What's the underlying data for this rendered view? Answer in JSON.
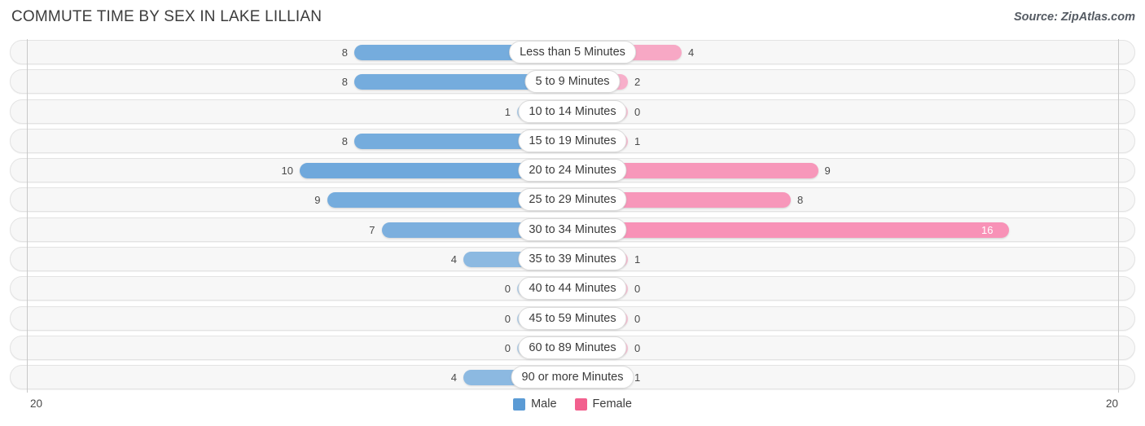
{
  "header": {
    "title": "COMMUTE TIME BY SEX IN LAKE LILLIAN",
    "source": "Source: ZipAtlas.com"
  },
  "legend": {
    "male_label": "Male",
    "female_label": "Female",
    "male_color": "#5b9bd5",
    "female_color": "#f2608e"
  },
  "axis": {
    "left_end_label": "20",
    "right_end_label": "20"
  },
  "chart_data": {
    "type": "bar",
    "title": "COMMUTE TIME BY SEX IN LAKE LILLIAN",
    "subtitle": "Source: ZipAtlas.com",
    "orientation": "horizontal-diverging",
    "xlabel": "",
    "ylabel": "",
    "xlim": [
      20,
      20
    ],
    "grid": false,
    "legend_position": "bottom-center",
    "categories": [
      "Less than 5 Minutes",
      "5 to 9 Minutes",
      "10 to 14 Minutes",
      "15 to 19 Minutes",
      "20 to 24 Minutes",
      "25 to 29 Minutes",
      "30 to 34 Minutes",
      "35 to 39 Minutes",
      "40 to 44 Minutes",
      "45 to 59 Minutes",
      "60 to 89 Minutes",
      "90 or more Minutes"
    ],
    "series": [
      {
        "name": "Male",
        "values": [
          8,
          8,
          1,
          8,
          10,
          9,
          7,
          4,
          0,
          0,
          0,
          4
        ]
      },
      {
        "name": "Female",
        "values": [
          4,
          2,
          0,
          1,
          9,
          8,
          16,
          1,
          0,
          0,
          0,
          1
        ]
      }
    ]
  }
}
